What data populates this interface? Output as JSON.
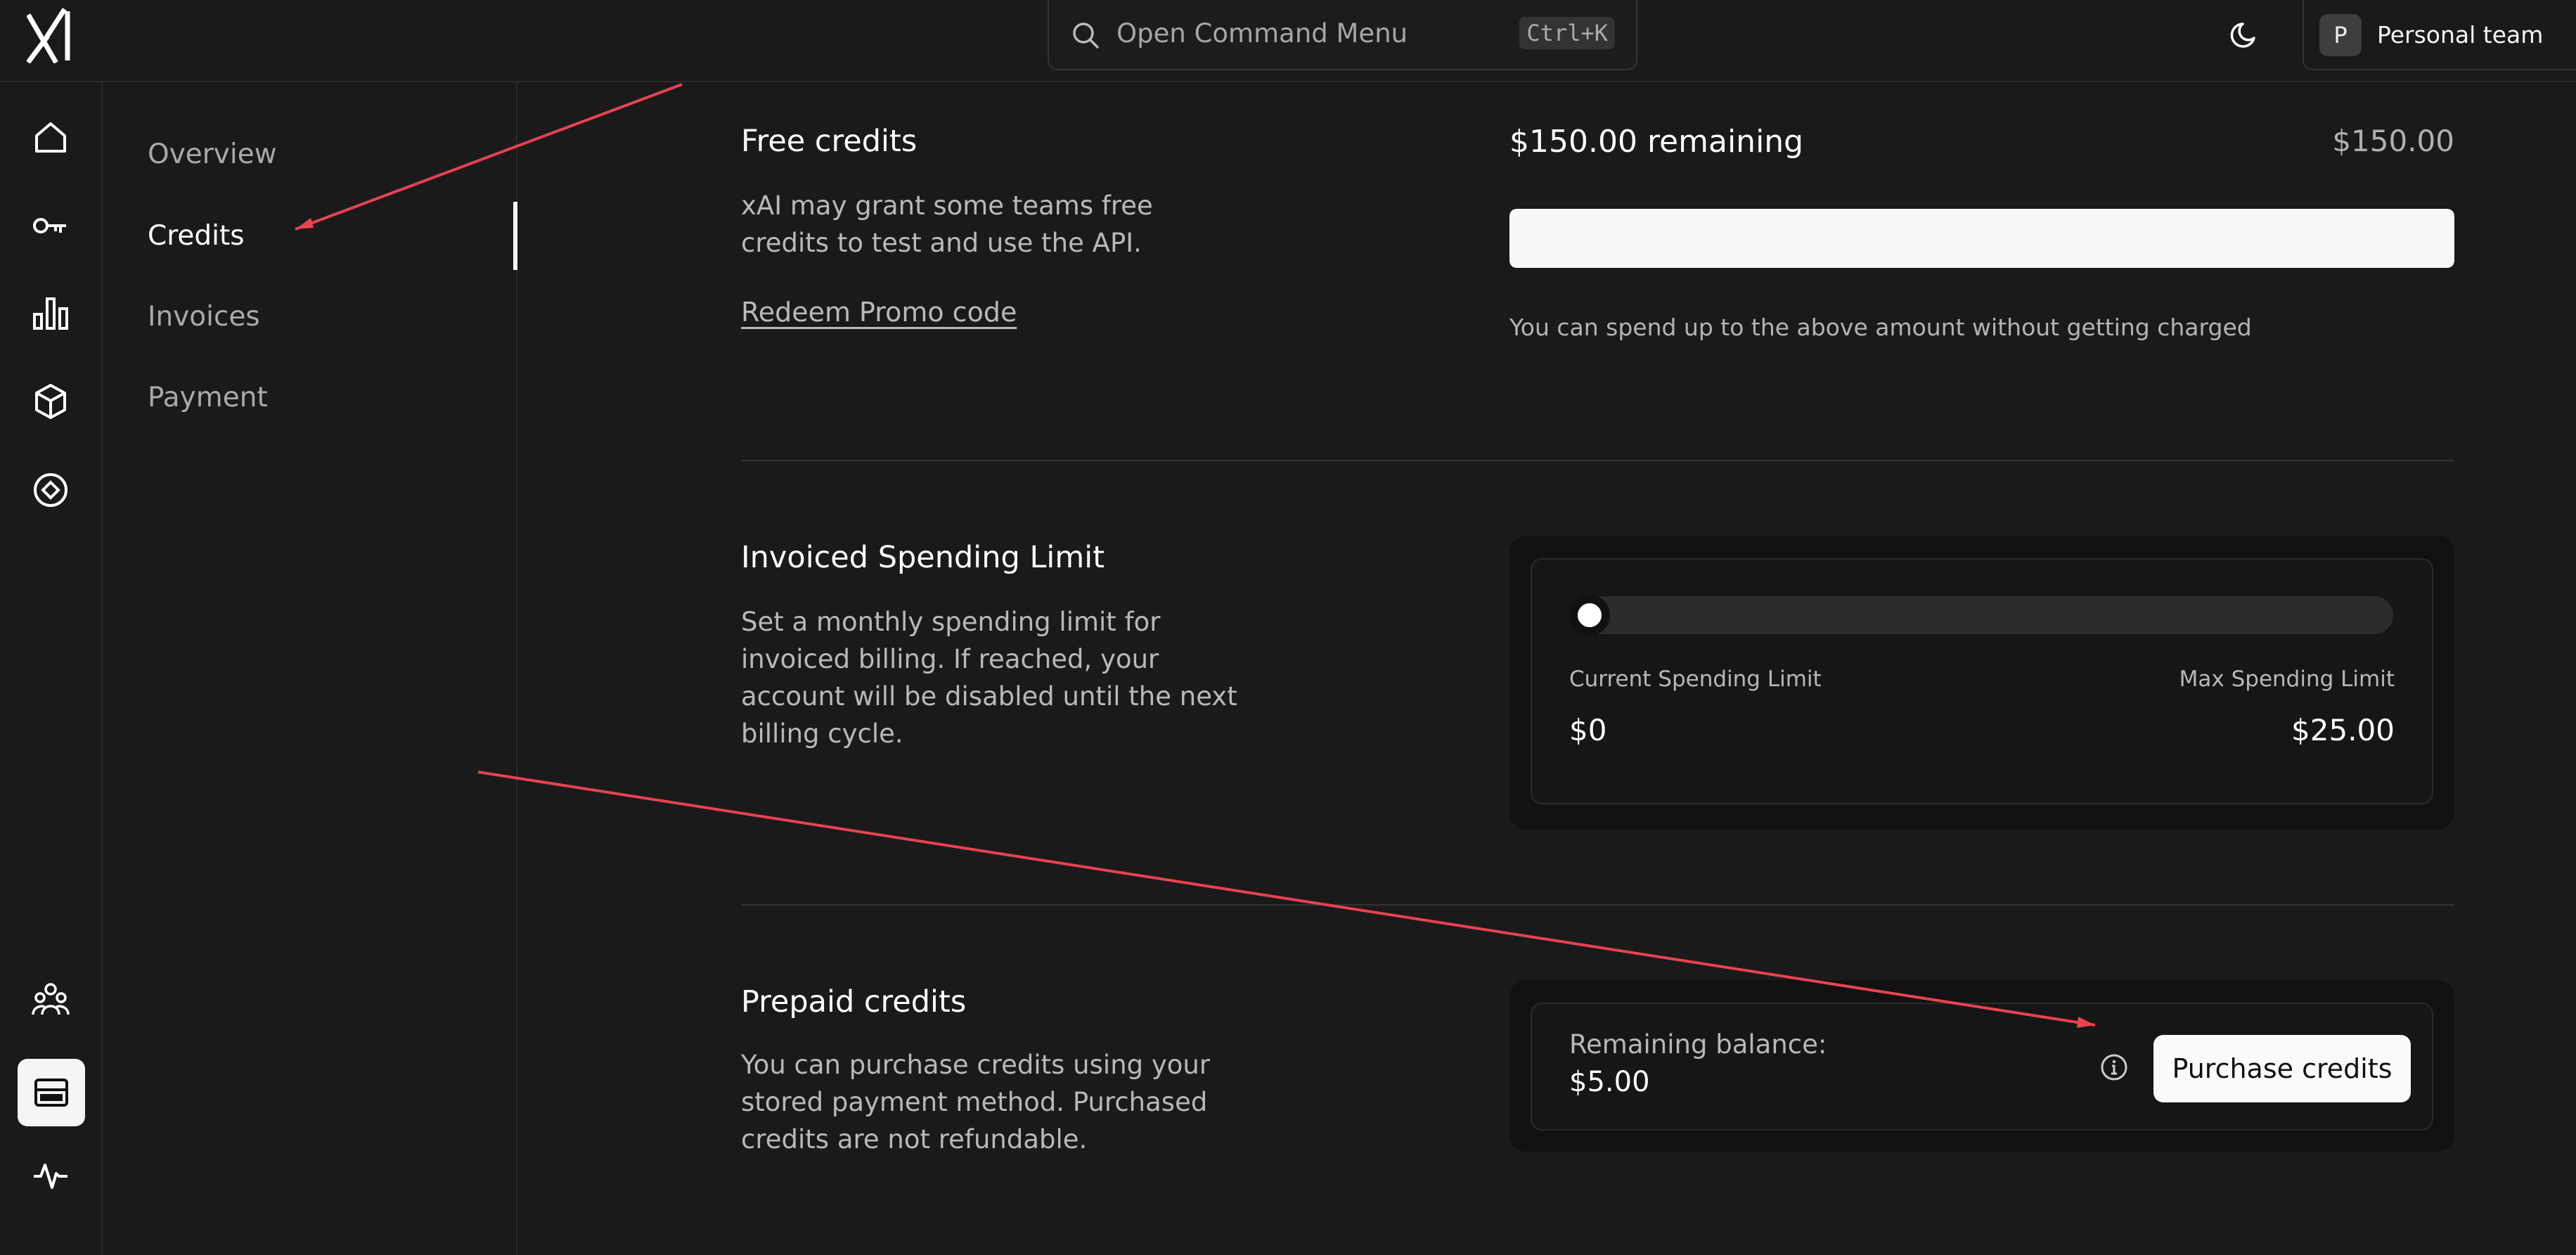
{
  "topbar": {
    "logo": "xAI",
    "command_placeholder": "Open Command Menu",
    "command_shortcut": "Ctrl+K",
    "team": {
      "avatar_letter": "P",
      "name": "Personal team"
    }
  },
  "rail": {
    "icons": [
      "home-icon",
      "key-icon",
      "bar-chart-icon",
      "cube-icon",
      "compass-icon",
      "team-icon",
      "billing-icon",
      "activity-icon"
    ],
    "active": "billing-icon"
  },
  "subnav": {
    "items": [
      {
        "label": "Overview"
      },
      {
        "label": "Credits"
      },
      {
        "label": "Invoices"
      },
      {
        "label": "Payment"
      }
    ],
    "active": "Credits"
  },
  "free_credits": {
    "title": "Free credits",
    "description": "xAI may grant some teams free credits to test and use the API.",
    "redeem_link": "Redeem Promo code",
    "remaining": "$150.00 remaining",
    "total": "$150.00",
    "remaining_fraction": 1.0,
    "note": "You can spend up to the above amount without getting charged"
  },
  "spending_limit": {
    "title": "Invoiced Spending Limit",
    "description": "Set a monthly spending limit for invoiced billing. If reached, your account will be disabled until the next billing cycle.",
    "current_label": "Current Spending Limit",
    "current_value": "$0",
    "max_label": "Max Spending Limit",
    "max_value": "$25.00",
    "slider_fraction": 0
  },
  "prepaid": {
    "title": "Prepaid credits",
    "description": "You can purchase credits using your stored payment method. Purchased credits are not refundable.",
    "balance_label": "Remaining balance:",
    "balance_value": "$5.00",
    "button": "Purchase credits"
  },
  "colors": {
    "background": "#1a1a1a",
    "annotation_arrow": "#e8434f",
    "accent": "#fafafa"
  }
}
